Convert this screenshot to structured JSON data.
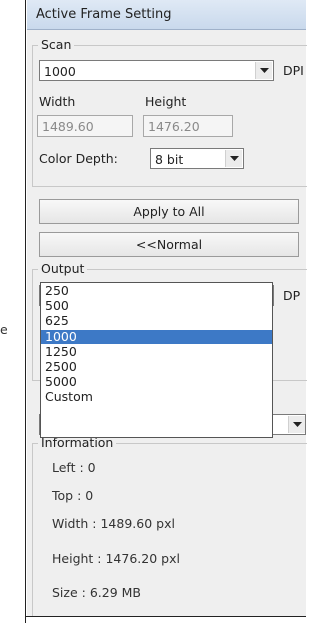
{
  "window": {
    "title": "Active Frame Setting"
  },
  "scan": {
    "legend": "Scan",
    "dpi_value": "1000",
    "dpi_unit": "DPI",
    "width_label": "Width",
    "height_label": "Height",
    "width_value": "1489.60",
    "height_value": "1476.20",
    "color_depth_label": "Color Depth:",
    "color_depth_value": "8 bit"
  },
  "buttons": {
    "apply_all": "Apply to All",
    "normal": "<<Normal"
  },
  "output": {
    "legend": "Output",
    "dpi_value": "1000",
    "dpi_unit": "DP",
    "options": [
      {
        "label": "250",
        "selected": false
      },
      {
        "label": "500",
        "selected": false
      },
      {
        "label": "625",
        "selected": false
      },
      {
        "label": "1000",
        "selected": true
      },
      {
        "label": "1250",
        "selected": false
      },
      {
        "label": "2500",
        "selected": false
      },
      {
        "label": "5000",
        "selected": false
      },
      {
        "label": "Custom",
        "selected": false
      }
    ]
  },
  "information": {
    "legend": "Information",
    "left": "Left : 0",
    "top": "Top : 0",
    "width": "Width : 1489.60 pxl",
    "height": "Height : 1476.20 pxl",
    "size": "Size : 6.29 MB"
  },
  "left_sliver_text": "e",
  "colors": {
    "selection": "#3d79c6",
    "title_bar": "#c9d9ec",
    "panel_bg": "#efefef"
  }
}
